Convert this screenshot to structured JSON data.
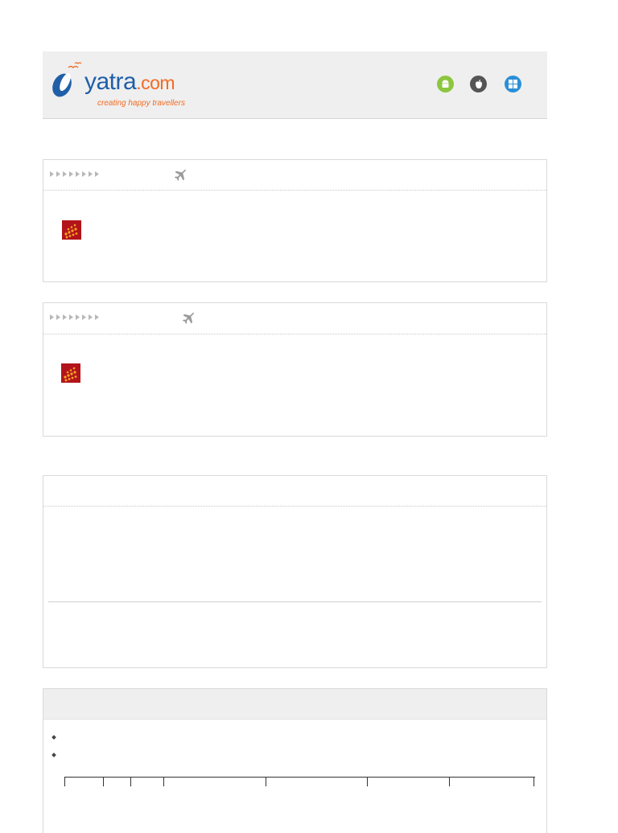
{
  "header": {
    "logo_word": "yatra",
    "logo_domain": ".com",
    "logo_tagline": "creating happy travellers",
    "app_icons": [
      {
        "name": "android-icon",
        "color": "#8cc63f"
      },
      {
        "name": "apple-icon",
        "color": "#555555"
      },
      {
        "name": "windows-icon",
        "color": "#2b8fd6"
      }
    ]
  },
  "colors": {
    "brand_blue": "#1f5fa8",
    "brand_orange": "#f26b21",
    "airline_red": "#b3141b",
    "panel_gray": "#efefef"
  },
  "flight_cards": [
    {
      "route_arrows": "▸▸▸▸▸▸▸▸",
      "icon": "plane-icon",
      "airline_icon": "airline-logo"
    },
    {
      "route_arrows": "▸▸▸▸▸▸▸▸",
      "icon": "plane-icon",
      "airline_icon": "airline-logo"
    }
  ]
}
